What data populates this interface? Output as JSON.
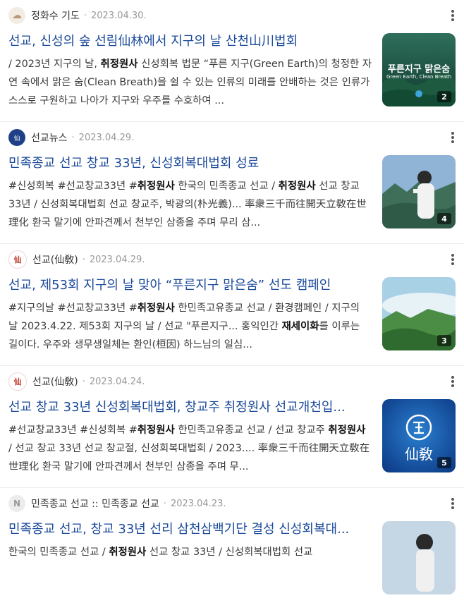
{
  "results": [
    {
      "author": "정화수 기도",
      "date": "2023.04.30.",
      "avatar_icon": "cloud-avatar-icon",
      "title": "선교, 신성의 숲 선림仙林에서 지구의 날 산천山川법회",
      "snippet": [
        {
          "t": "/ 2023년 지구의 날, ",
          "b": false
        },
        {
          "t": "취정원사",
          "b": true
        },
        {
          "t": " 신성회복 법문 “푸른 지구(Green Earth)의 청정한 자연 속에서 맑은 숨(Clean Breath)을 쉴 수 있는 인류의 미래를 안배하는 것은 인류가 스스로 구원하고 나아가 지구와 우주를 수호하여 ...",
          "b": false
        }
      ],
      "thumb_title": "푸른지구 맑은숨",
      "thumb_subtitle": "Green Earth, Clean Breath",
      "thumb_count": "2"
    },
    {
      "author": "선교뉴스",
      "date": "2023.04.29.",
      "avatar_icon": "news-logo-avatar-icon",
      "title": "민족종교 선교 창교 33년, 신성회복대법회 성료",
      "snippet": [
        {
          "t": "#신성회복 #선교창교33년 #",
          "b": false
        },
        {
          "t": "취정원사",
          "b": true
        },
        {
          "t": " 한국의 민족종교 선교 / ",
          "b": false
        },
        {
          "t": "취정원사",
          "b": true
        },
        {
          "t": " 선교 창교 33년 / 신성회복대법회 선교 창교주, 박광의(朴光義)... 率衆三千而往開天立敎在世理化 환국 말기에 안파견께서 천부인 삼종을 주며 무리 삼...",
          "b": false
        }
      ],
      "thumb_title": "",
      "thumb_subtitle": "",
      "thumb_count": "4"
    },
    {
      "author": "선교(仙敎)",
      "date": "2023.04.29.",
      "avatar_icon": "seal-avatar-icon",
      "title": "선교, 제53회 지구의 날 맞아 “푸른지구 맑은숨” 선도 캠페인",
      "snippet": [
        {
          "t": "#지구의날 #선교창교33년 #",
          "b": false
        },
        {
          "t": "취정원사",
          "b": true
        },
        {
          "t": " 한민족고유종교 선교 / 환경캠페인 / 지구의 날 2023.4.22. 제53회 지구의 날 / 선교 \"푸른지구... 홍익인간 ",
          "b": false
        },
        {
          "t": "재세이화",
          "b": true
        },
        {
          "t": "를 이루는 길이다. 우주와 생무생일체는 환인(桓因) 하느님의 일심...",
          "b": false
        }
      ],
      "thumb_title": "",
      "thumb_subtitle": "",
      "thumb_count": "3"
    },
    {
      "author": "선교(仙敎)",
      "date": "2023.04.24.",
      "avatar_icon": "seal-avatar-icon",
      "title": "선교 창교 33년 신성회복대법회, 창교주 취정원사 선교개천입...",
      "snippet": [
        {
          "t": "#선교창교33년 #신성회복 #",
          "b": false
        },
        {
          "t": "취정원사",
          "b": true
        },
        {
          "t": " 한민족고유종교 선교 / 선교 창교주 ",
          "b": false
        },
        {
          "t": "취정원사",
          "b": true
        },
        {
          "t": " / 선교 창교 33년 선교 창교절, 신성회복대법회 / 2023.... 率衆三千而往開天立敎在世理化 환국 말기에 안파견께서 천부인 삼종을 주며 무...",
          "b": false
        }
      ],
      "thumb_title": "仙敎",
      "thumb_subtitle": "",
      "thumb_count": "5"
    },
    {
      "author": "민족종교 선교 :: 민족종교 선교",
      "date": "2023.04.23.",
      "avatar_icon": "n-avatar-icon",
      "title": "민족종교 선교, 창교 33년 선리 삼천삼백기단 결성 신성회복대...",
      "snippet": [
        {
          "t": "한국의 민족종교 선교 / ",
          "b": false
        },
        {
          "t": "취정원사",
          "b": true
        },
        {
          "t": " 선교 창교 33년 / 신성회복대법회 선교",
          "b": false
        }
      ],
      "thumb_title": "",
      "thumb_subtitle": "",
      "thumb_count": ""
    }
  ]
}
